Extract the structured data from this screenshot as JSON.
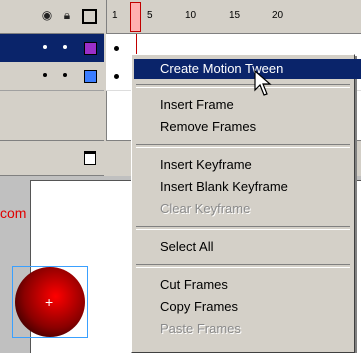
{
  "ruler": {
    "ticks": [
      "1",
      "5",
      "10",
      "15",
      "20"
    ]
  },
  "stage": {
    "text": "com"
  },
  "menu": {
    "items": [
      {
        "label": "Create Motion Tween",
        "state": "selected"
      },
      {
        "label": "Insert Frame",
        "state": "enabled"
      },
      {
        "label": "Remove Frames",
        "state": "enabled"
      },
      {
        "label": "Insert Keyframe",
        "state": "enabled"
      },
      {
        "label": "Insert Blank Keyframe",
        "state": "enabled"
      },
      {
        "label": "Clear Keyframe",
        "state": "disabled"
      },
      {
        "label": "Select All",
        "state": "enabled"
      },
      {
        "label": "Cut Frames",
        "state": "enabled"
      },
      {
        "label": "Copy Frames",
        "state": "enabled"
      },
      {
        "label": "Paste Frames",
        "state": "disabled"
      }
    ]
  },
  "colors": {
    "selection": "#0a246a",
    "layer1_outline": "#9b2fc9",
    "layer2_outline": "#3b7dff",
    "stage_text": "#e00000",
    "ball": "#cc0000"
  },
  "icons": {
    "header": [
      "eye-icon",
      "lock-icon",
      "outline-icon"
    ],
    "footer": [
      "trash-icon"
    ]
  }
}
